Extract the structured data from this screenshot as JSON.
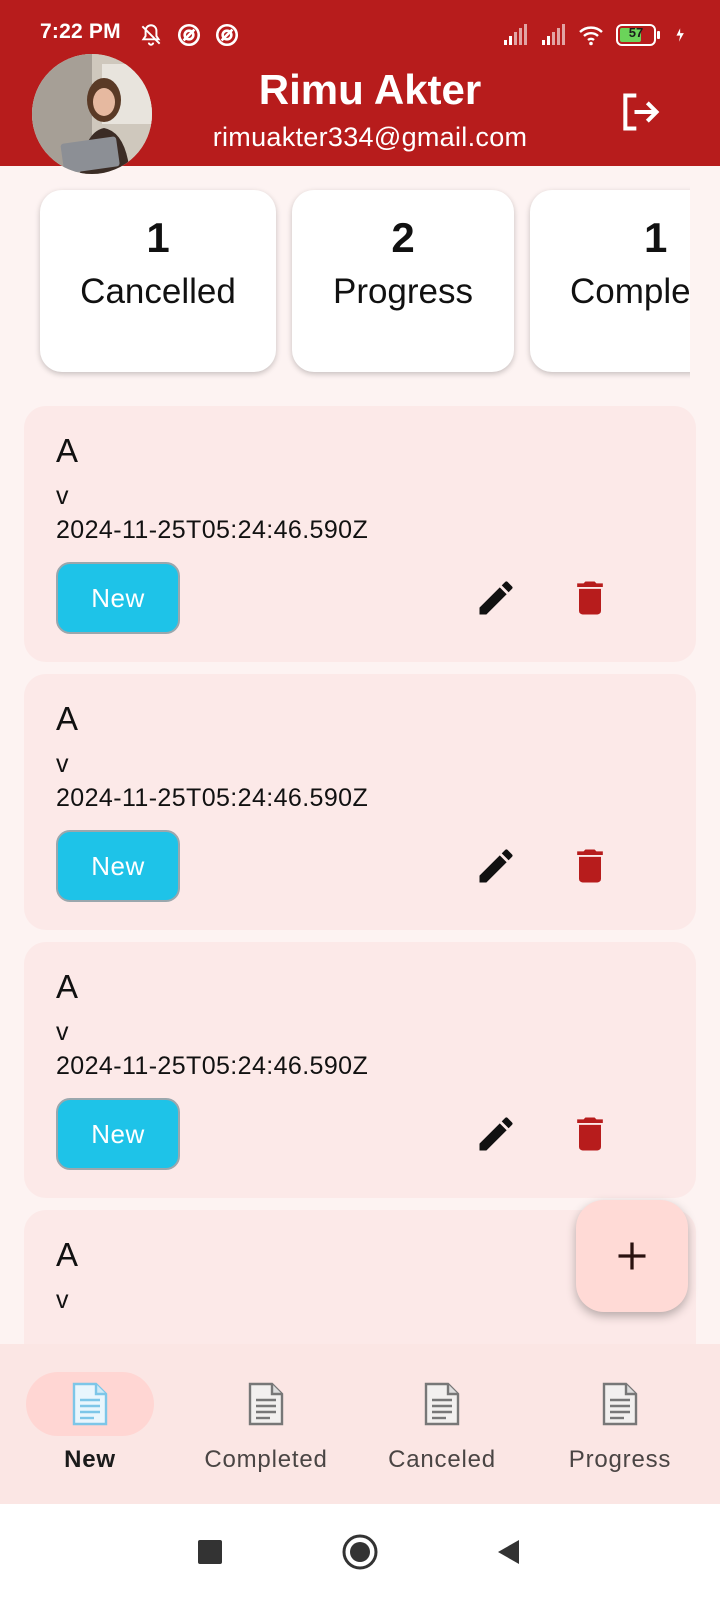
{
  "status_bar": {
    "time": "7:22 PM",
    "left_icons": [
      "notifications-off-icon",
      "data-saver-icon",
      "data-saver-icon"
    ],
    "right_icons": [
      "signal-icon",
      "signal-icon",
      "wifi-icon",
      "battery-icon",
      "charging-icon"
    ],
    "battery_level": "57"
  },
  "header": {
    "user_name": "Rimu Akter",
    "user_email": "rimuakter334@gmail.com",
    "logout_icon": "logout-icon",
    "background_color": "#b71c1c"
  },
  "summary": {
    "cards": [
      {
        "count": "1",
        "label": "Cancelled"
      },
      {
        "count": "2",
        "label": "Progress"
      },
      {
        "count": "1",
        "label": "Completed"
      }
    ]
  },
  "tasks": [
    {
      "title": "A",
      "description": "v",
      "date": "2024-11-25T05:24:46.590Z",
      "status": "New"
    },
    {
      "title": "A",
      "description": "v",
      "date": "2024-11-25T05:24:46.590Z",
      "status": "New"
    },
    {
      "title": "A",
      "description": "v",
      "date": "2024-11-25T05:24:46.590Z",
      "status": "New"
    },
    {
      "title": "A",
      "description": "v",
      "date": "",
      "status": ""
    }
  ],
  "colors": {
    "chip": "#1ec3e8",
    "delete": "#b71c1c",
    "card": "#fce9e8"
  },
  "fab": {
    "icon": "plus-icon"
  },
  "bottom_nav": {
    "active_index": 0,
    "items": [
      {
        "label": "New",
        "icon": "document-icon"
      },
      {
        "label": "Completed",
        "icon": "document-icon"
      },
      {
        "label": "Canceled",
        "icon": "document-icon"
      },
      {
        "label": "Progress",
        "icon": "document-icon"
      }
    ]
  },
  "system_nav": {
    "buttons": [
      "recents-icon",
      "home-icon",
      "back-icon"
    ]
  }
}
